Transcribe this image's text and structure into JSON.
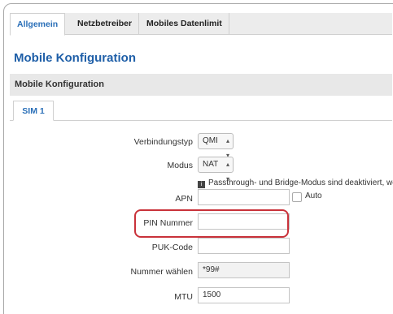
{
  "tabs": [
    "Allgemein",
    "Netzbetreiber",
    "Mobiles Datenlimit"
  ],
  "page_title": "Mobile Konfiguration",
  "section_title": "Mobile Konfiguration",
  "subtab": "SIM 1",
  "form": {
    "verbindungstyp": {
      "label": "Verbindungstyp",
      "value": "QMI"
    },
    "modus": {
      "label": "Modus",
      "value": "NAT"
    },
    "note": "Passthrough- und Bridge-Modus sind deaktiviert, wer",
    "apn": {
      "label": "APN",
      "value": "",
      "checkbox_label": "Auto"
    },
    "pin": {
      "label": "PIN Nummer",
      "value": ""
    },
    "puk": {
      "label": "PUK-Code",
      "value": ""
    },
    "dial": {
      "label": "Nummer wählen",
      "value": "*99#"
    },
    "mtu": {
      "label": "MTU",
      "value": "1500"
    }
  },
  "colors": {
    "accent": "#2a6fb8",
    "highlight": "#c9323a"
  }
}
